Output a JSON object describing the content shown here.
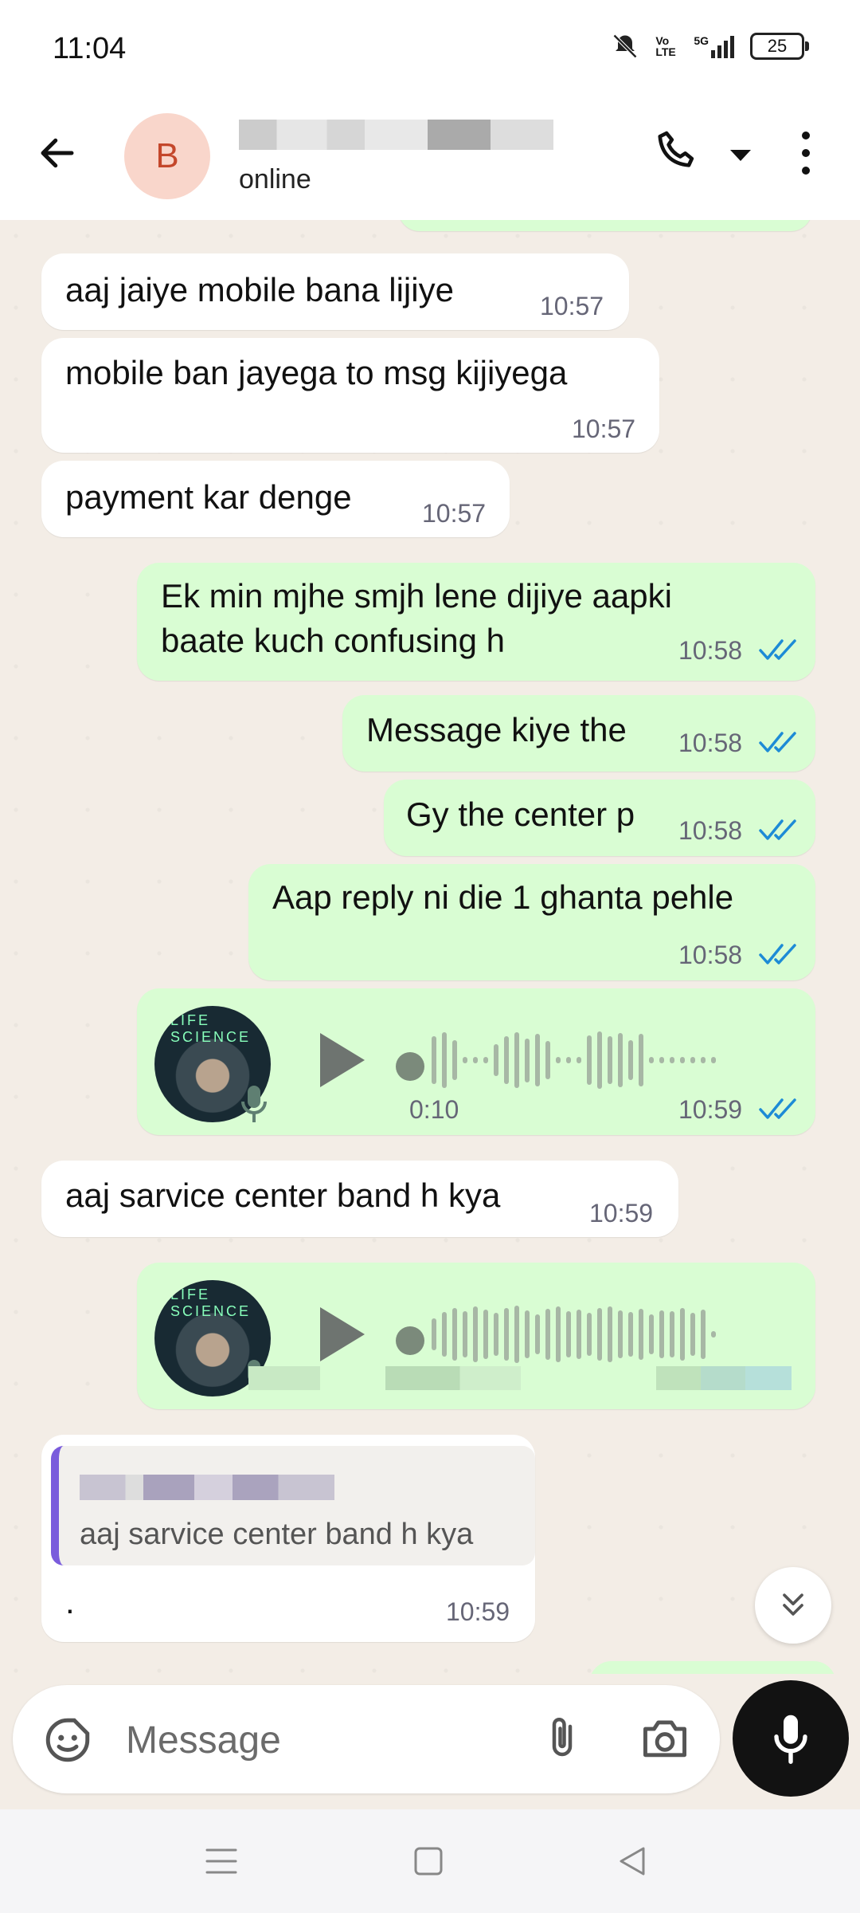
{
  "status_bar": {
    "time": "11:04",
    "battery": "25",
    "network": "5G",
    "volte": "Vo LTE"
  },
  "header": {
    "avatar_initial": "B",
    "status": "online"
  },
  "messages": [
    {
      "text": "aaj jaiye mobile bana lijiye",
      "time": "10:57",
      "direction": "in"
    },
    {
      "text": "mobile ban jayega to msg kijiyega",
      "time": "10:57",
      "direction": "in"
    },
    {
      "text": "payment kar denge",
      "time": "10:57",
      "direction": "in"
    },
    {
      "text_line1": "Ek min mjhe smjh lene dijiye aapki",
      "text_line2": "baate kuch confusing h",
      "time": "10:58",
      "direction": "out",
      "read": true
    },
    {
      "text": "Message kiye the",
      "time": "10:58",
      "direction": "out",
      "read": true
    },
    {
      "text": "Gy the center p",
      "time": "10:58",
      "direction": "out",
      "read": true
    },
    {
      "text": "Aap reply ni die 1 ghanta pehle",
      "time": "10:58",
      "direction": "out",
      "read": true
    },
    {
      "type": "voice",
      "duration": "0:10",
      "time": "10:59",
      "direction": "out",
      "read": true,
      "thumb_title": "LIFE SCIENCE"
    },
    {
      "text": "aaj sarvice center band h kya",
      "time": "10:59",
      "direction": "in"
    },
    {
      "type": "voice",
      "direction": "out",
      "thumb_title": "LIFE SCIENCE"
    },
    {
      "quoted_text": "aaj sarvice center band h kya",
      "text": ".",
      "time": "10:59",
      "direction": "in"
    }
  ],
  "input": {
    "placeholder": "Message"
  },
  "colors": {
    "outgoing_bubble": "#d9fdd3",
    "incoming_bubble": "#ffffff",
    "read_tick": "#1d8bd6",
    "chat_bg": "#f3ede6",
    "avatar_bg": "#f9d6cb"
  },
  "icons": [
    "back-arrow-icon",
    "phone-icon",
    "chevron-down-icon",
    "more-vertical-icon",
    "double-check-icon",
    "play-icon",
    "mic-icon",
    "emoji-sticker-icon",
    "paperclip-icon",
    "camera-icon",
    "chevron-double-down-icon",
    "menu-icon",
    "home-square-icon",
    "back-triangle-icon"
  ]
}
